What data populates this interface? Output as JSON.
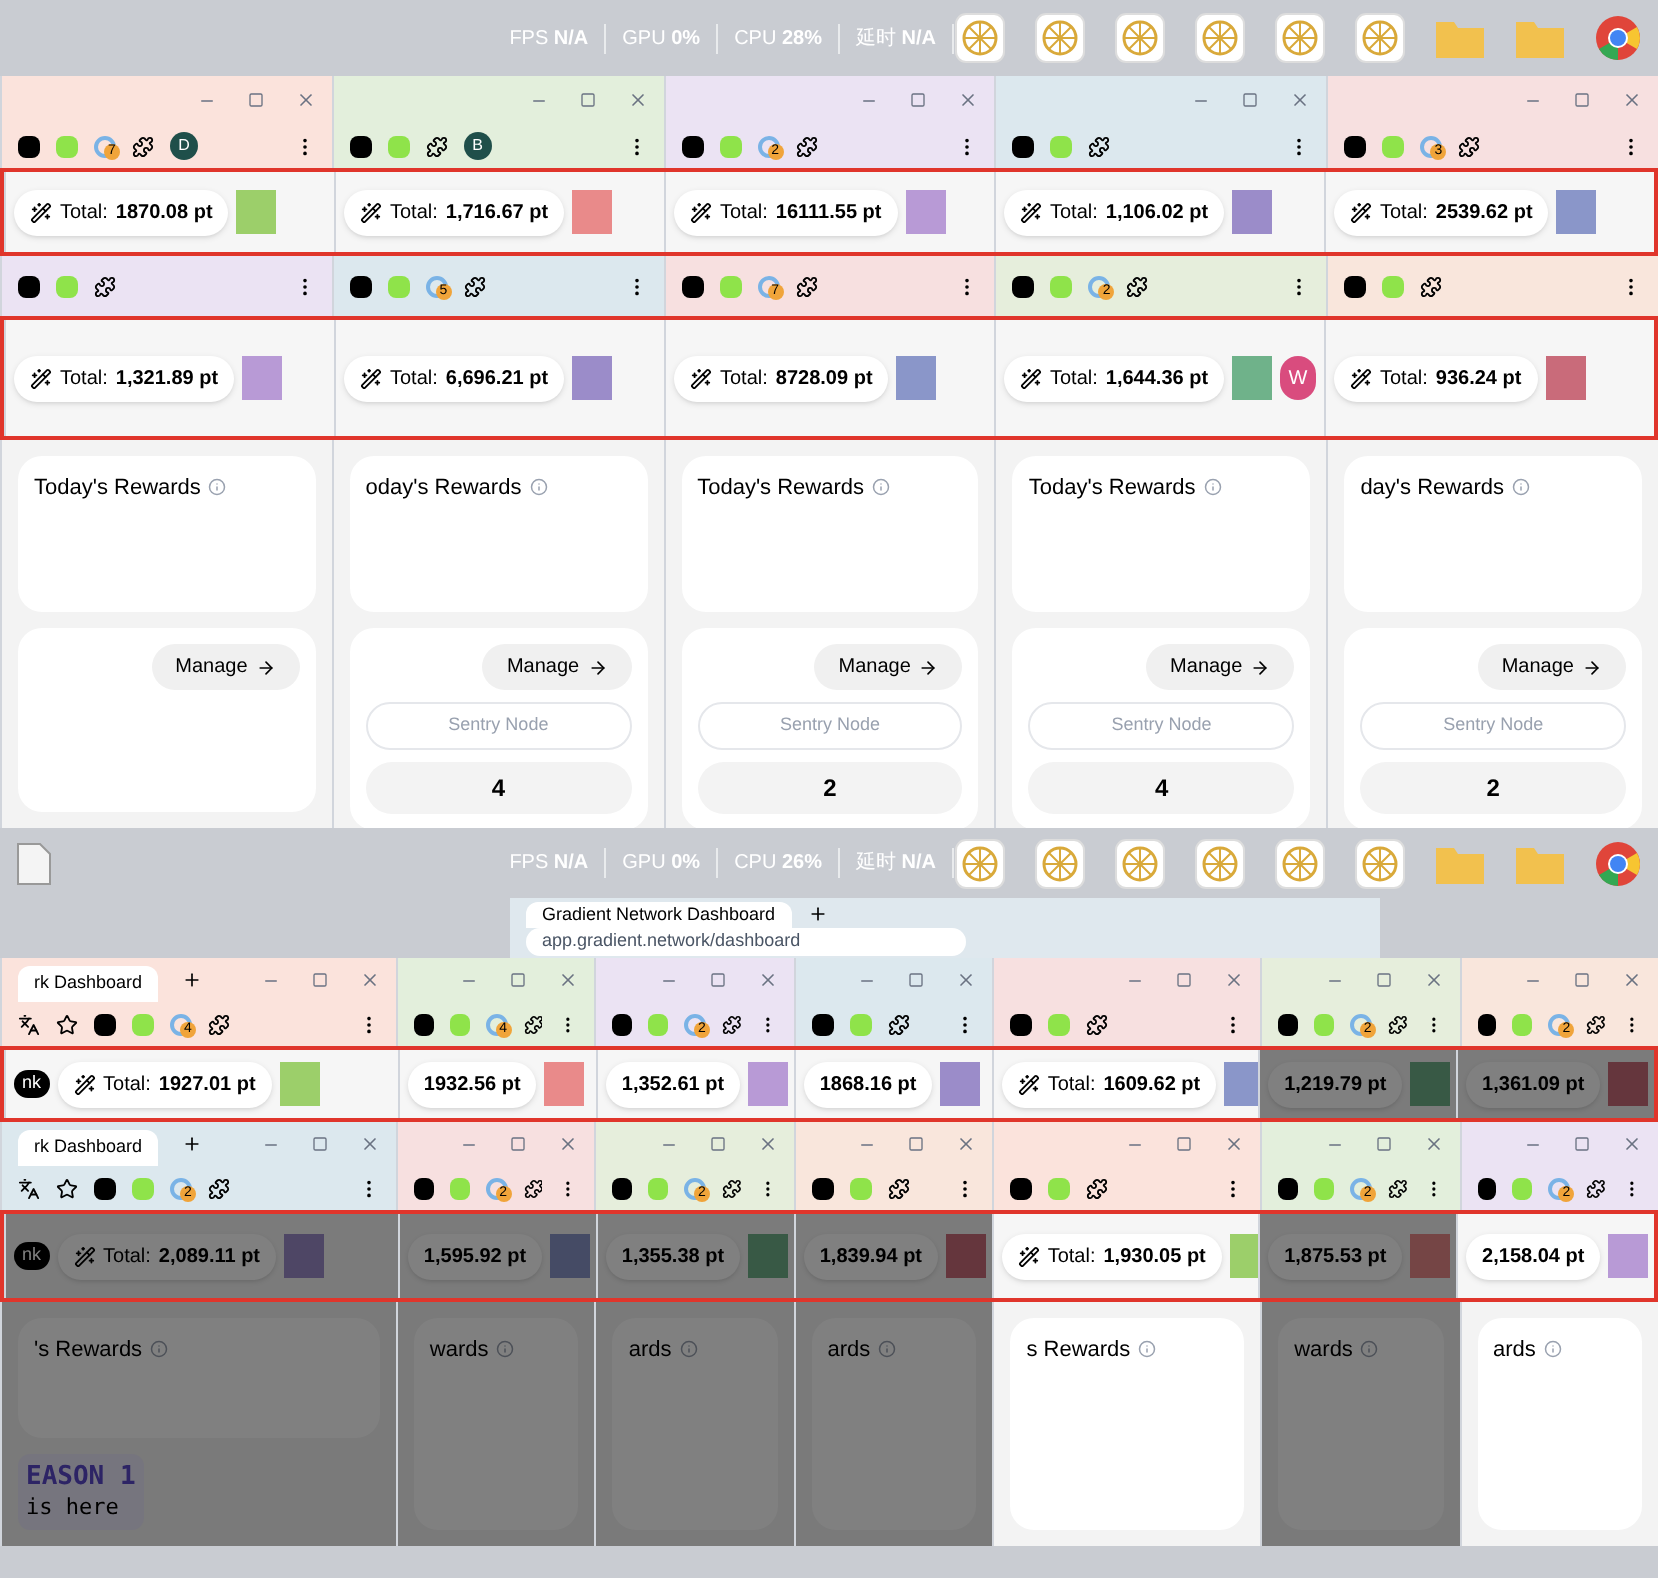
{
  "screens": [
    {
      "system_bar": [
        {
          "label": "FPS",
          "value": "N/A"
        },
        {
          "label": "GPU",
          "value": "0%"
        },
        {
          "label": "CPU",
          "value": "28%"
        },
        {
          "label": "延时",
          "value": "N/A"
        }
      ],
      "rows": [
        {
          "windows": [
            {
              "badge": "7",
              "profile": "D",
              "total_label": "Total:",
              "total": "1870.08 pt"
            },
            {
              "profile": "B",
              "total_label": "Total:",
              "total": "1,716.67 pt"
            },
            {
              "badge": "2",
              "total_label": "Total:",
              "total": "16111.55 pt"
            },
            {
              "total_label": "Total:",
              "total": "1,106.02 pt"
            },
            {
              "badge": "3",
              "total_label": "Total:",
              "total": "2539.62 pt"
            }
          ]
        },
        {
          "windows": [
            {
              "total_label": "Total:",
              "total": "1,321.89 pt",
              "rewards_title": "Today's Rewards",
              "manage": "Manage"
            },
            {
              "badge": "5",
              "total_label": "Total:",
              "total": "6,696.21 pt",
              "rewards_title": "oday's Rewards",
              "manage": "Manage",
              "sentry": "Sentry Node",
              "node_count": "4"
            },
            {
              "badge": "7",
              "total_label": "Total:",
              "total": "8728.09 pt",
              "rewards_title": "Today's Rewards",
              "manage": "Manage",
              "sentry": "Sentry Node",
              "node_count": "2"
            },
            {
              "badge": "2",
              "total_label": "Total:",
              "total": "1,644.36 pt",
              "strip_avatar": "W",
              "rewards_title": "Today's Rewards",
              "manage": "Manage",
              "sentry": "Sentry Node",
              "node_count": "4"
            },
            {
              "total_label": "Total:",
              "total": "936.24 pt",
              "rewards_title": "day's Rewards",
              "manage": "Manage",
              "sentry": "Sentry Node",
              "node_count": "2"
            }
          ]
        }
      ]
    },
    {
      "system_bar": [
        {
          "label": "FPS",
          "value": "N/A"
        },
        {
          "label": "GPU",
          "value": "0%"
        },
        {
          "label": "CPU",
          "value": "26%"
        },
        {
          "label": "延时",
          "value": "N/A"
        }
      ],
      "back_window": {
        "tab": "Gradient Network Dashboard",
        "url": "app.gradient.network/dashboard"
      },
      "rows": [
        {
          "windows": [
            {
              "tab": "rk Dashboard",
              "badge": "4",
              "pill": "nk",
              "total_label": "Total:",
              "total": "1927.01 pt",
              "dimmed": false
            },
            {
              "badge": "4",
              "total": "1932.56 pt",
              "dimmed": false
            },
            {
              "badge": "2",
              "total": "1,352.61 pt",
              "dimmed": false
            },
            {
              "total": "1868.16 pt",
              "dimmed": false
            },
            {
              "total_label": "Total:",
              "total": "1609.62 pt",
              "dimmed": false
            },
            {
              "badge": "2",
              "total": "1,219.79 pt",
              "dimmed": true
            },
            {
              "badge": "2",
              "total": "1,361.09 pt",
              "dimmed": true
            }
          ]
        },
        {
          "windows": [
            {
              "tab": "rk Dashboard",
              "badge": "2",
              "pill": "nk",
              "total_label": "Total:",
              "total": "2,089.11 pt",
              "rewards_title": "'s Rewards",
              "season": [
                "EASON 1",
                "is here"
              ],
              "dimmed": true
            },
            {
              "badge": "2",
              "total": "1,595.92 pt",
              "rewards_title": "wards",
              "dimmed": true
            },
            {
              "badge": "2",
              "total": "1,355.38 pt",
              "rewards_title": "ards",
              "dimmed": true
            },
            {
              "total": "1,839.94 pt",
              "rewards_title": "ards",
              "dimmed": true
            },
            {
              "total_label": "Total:",
              "total": "1,930.05 pt",
              "rewards_title": "s Rewards",
              "dimmed": false
            },
            {
              "badge": "2",
              "total": "1,875.53 pt",
              "rewards_title": "wards",
              "dimmed": true
            },
            {
              "badge": "2",
              "total": "2,158.04 pt",
              "rewards_title": "ards",
              "dimmed": false
            }
          ]
        }
      ]
    }
  ]
}
